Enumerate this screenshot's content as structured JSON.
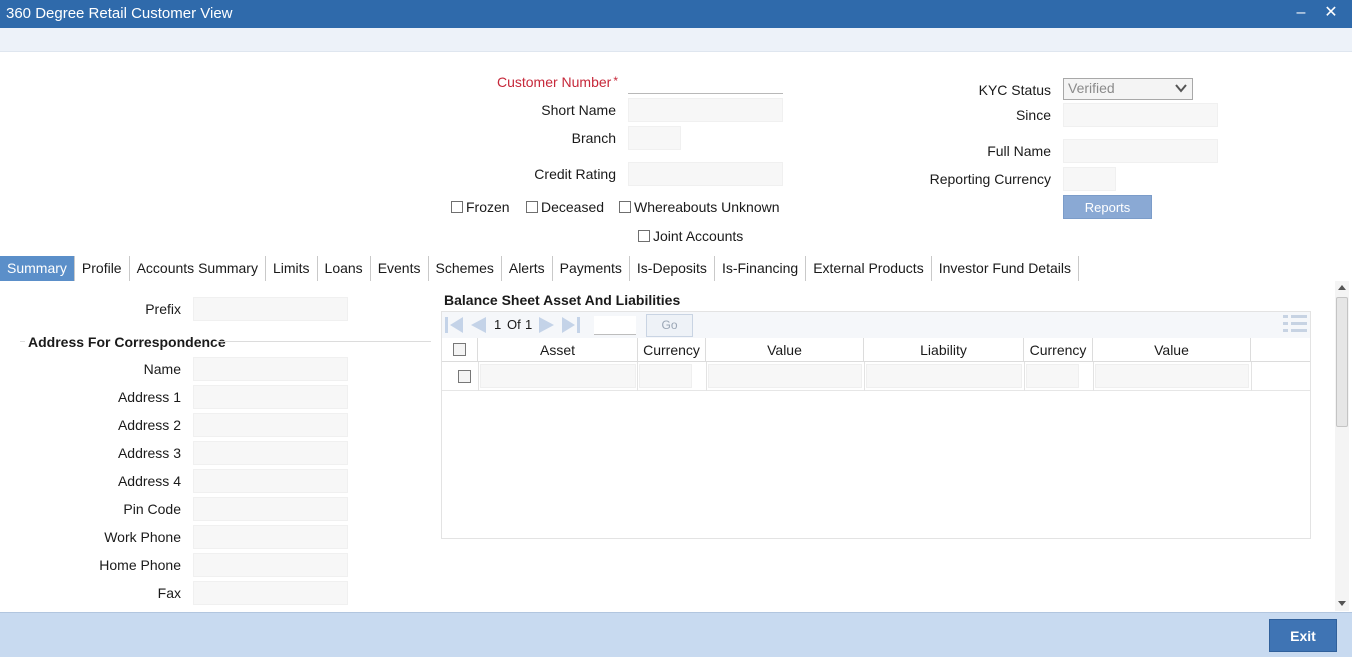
{
  "window": {
    "title": "360 Degree Retail Customer View",
    "minimize_glyph": "–",
    "close_glyph": "✕"
  },
  "header": {
    "customer_number_label": "Customer Number",
    "required_mark": "*",
    "short_name_label": "Short Name",
    "branch_label": "Branch",
    "credit_rating_label": "Credit Rating",
    "kyc_status_label": "KYC Status",
    "kyc_status_value": "Verified",
    "since_label": "Since",
    "full_name_label": "Full Name",
    "reporting_currency_label": "Reporting Currency",
    "frozen_label": "Frozen",
    "deceased_label": "Deceased",
    "whereabouts_label": "Whereabouts Unknown",
    "joint_accounts_label": "Joint Accounts",
    "reports_button": "Reports"
  },
  "tabs": [
    {
      "label": "Summary",
      "active": true
    },
    {
      "label": "Profile"
    },
    {
      "label": "Accounts Summary"
    },
    {
      "label": "Limits"
    },
    {
      "label": "Loans"
    },
    {
      "label": "Events"
    },
    {
      "label": "Schemes"
    },
    {
      "label": "Alerts"
    },
    {
      "label": "Payments"
    },
    {
      "label": "Is-Deposits"
    },
    {
      "label": "Is-Financing"
    },
    {
      "label": "External Products"
    },
    {
      "label": "Investor Fund Details"
    }
  ],
  "summary": {
    "prefix_label": "Prefix",
    "address_heading": "Address For Correspondence",
    "name_label": "Name",
    "address1_label": "Address 1",
    "address2_label": "Address 2",
    "address3_label": "Address 3",
    "address4_label": "Address 4",
    "pin_code_label": "Pin Code",
    "work_phone_label": "Work Phone",
    "home_phone_label": "Home Phone",
    "fax_label": "Fax"
  },
  "balance_sheet": {
    "heading": "Balance Sheet Asset And Liabilities",
    "pager": {
      "current": "1",
      "of_label": "Of",
      "total": "1",
      "go_label": "Go"
    },
    "columns": [
      "Asset",
      "Currency",
      "Value",
      "Liability",
      "Currency",
      "Value"
    ]
  },
  "footer": {
    "exit_button": "Exit"
  },
  "colors": {
    "titlebar": "#2f6aab",
    "active_tab": "#5b8fc9",
    "required": "#c6283a",
    "footer": "#c8daf0",
    "exit_button": "#3f74b4"
  }
}
